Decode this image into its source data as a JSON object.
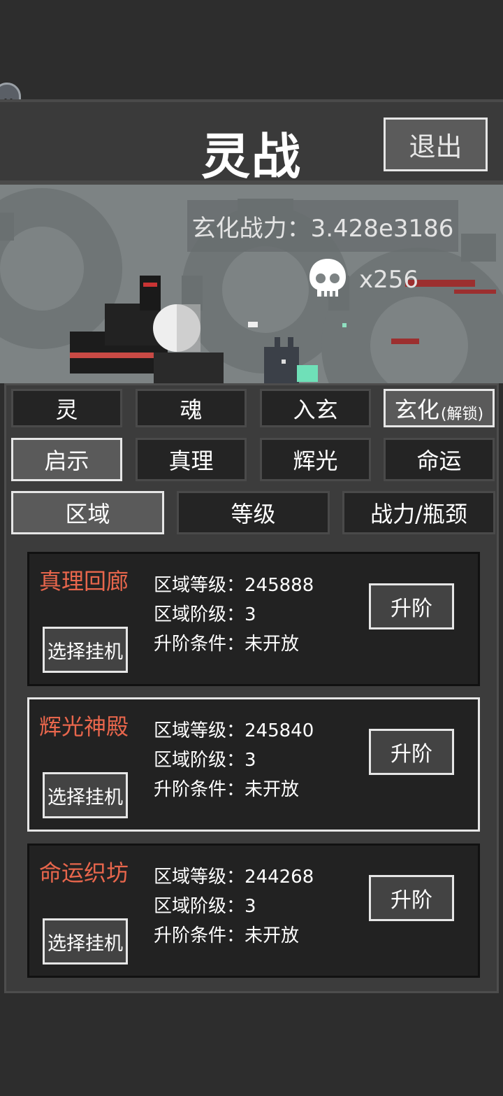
{
  "header": {
    "title": "灵战",
    "exit_label": "退出"
  },
  "battle": {
    "power_text": "玄化战力：3.428e3186",
    "kill_text": "x256"
  },
  "tabs_row1": [
    {
      "label": "灵"
    },
    {
      "label": "魂"
    },
    {
      "label": "入玄"
    },
    {
      "label": "玄化",
      "note": "(解锁)"
    }
  ],
  "tabs_row2": [
    {
      "label": "启示"
    },
    {
      "label": "真理"
    },
    {
      "label": "辉光"
    },
    {
      "label": "命运"
    }
  ],
  "tabs_row3": [
    {
      "label": "区域"
    },
    {
      "label": "等级"
    },
    {
      "label": "战力/瓶颈"
    }
  ],
  "zones": [
    {
      "name": "真理回廊",
      "level": "区域等级：245888",
      "tier": "区域阶级：3",
      "condition": "升阶条件：未开放",
      "select_label": "选择挂机",
      "upgrade_label": "升阶"
    },
    {
      "name": "辉光神殿",
      "level": "区域等级：245840",
      "tier": "区域阶级：3",
      "condition": "升阶条件：未开放",
      "select_label": "选择挂机",
      "upgrade_label": "升阶"
    },
    {
      "name": "命运织坊",
      "level": "区域等级：244268",
      "tier": "区域阶级：3",
      "condition": "升阶条件：未开放",
      "select_label": "选择挂机",
      "upgrade_label": "升阶"
    }
  ],
  "colors": {
    "zone_name": "#e8664c",
    "active_border": "#e6e6e6",
    "background": "#2d2d2d"
  },
  "icons": {
    "floating": "pause-bubble-icon",
    "kills": "skull-icon"
  }
}
